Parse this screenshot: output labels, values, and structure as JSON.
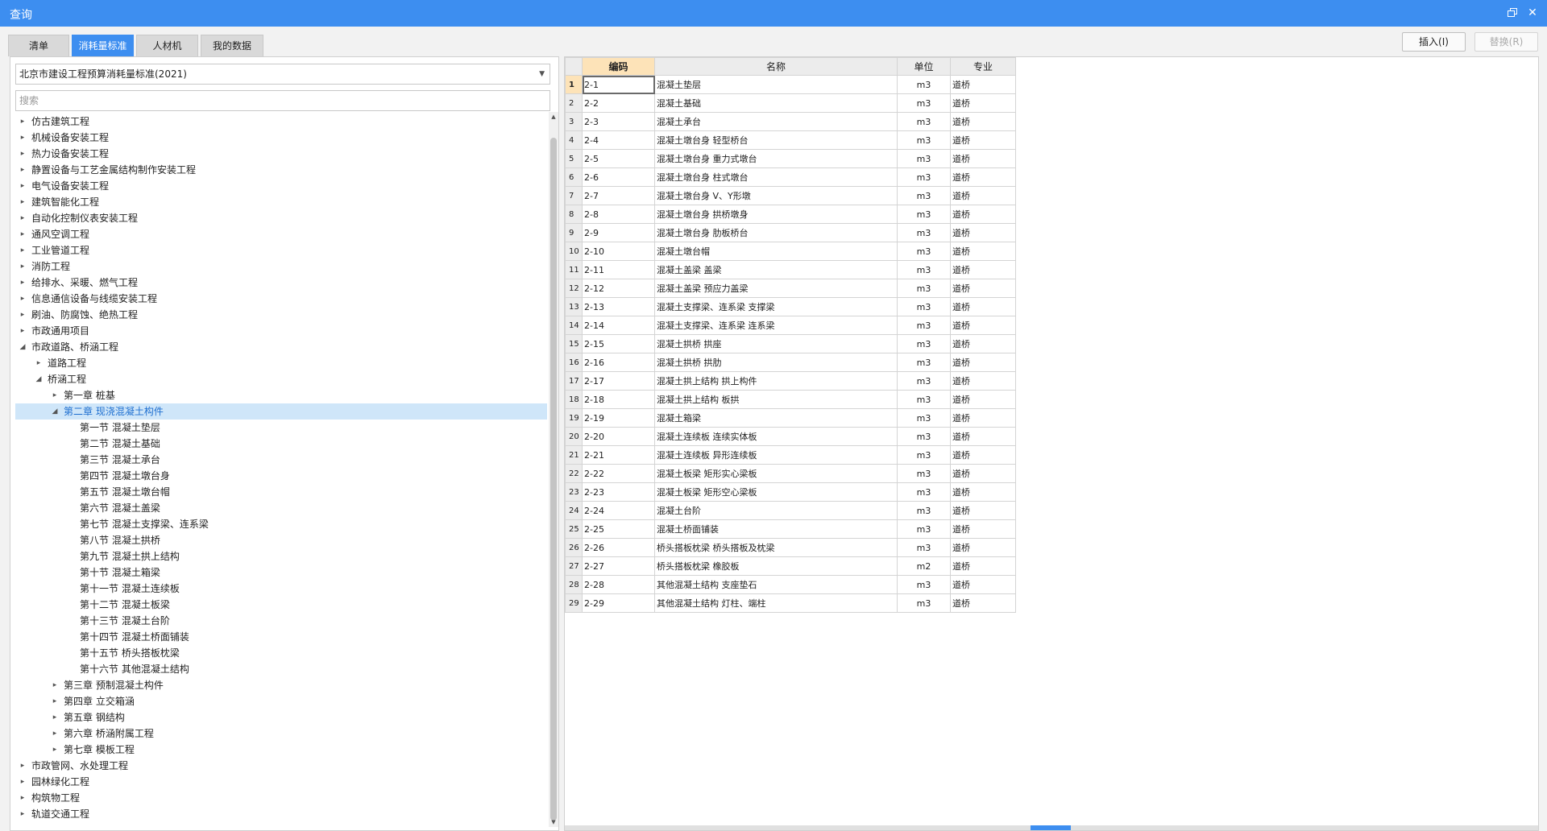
{
  "window": {
    "title": "查询",
    "restore_glyph": "restore-icon",
    "close_glyph": "✕"
  },
  "tabs": [
    {
      "label": "清单",
      "active": false
    },
    {
      "label": "消耗量标准",
      "active": true
    },
    {
      "label": "人材机",
      "active": false
    },
    {
      "label": "我的数据",
      "active": false
    }
  ],
  "buttons": {
    "insert": "插入(I)",
    "replace": "替换(R)"
  },
  "left": {
    "standard_select": "北京市建设工程预算消耗量标准(2021)",
    "search_placeholder": "搜索",
    "tree": [
      {
        "label": "仿古建筑工程",
        "level": 0,
        "state": "collapsed"
      },
      {
        "label": "机械设备安装工程",
        "level": 0,
        "state": "collapsed"
      },
      {
        "label": "热力设备安装工程",
        "level": 0,
        "state": "collapsed"
      },
      {
        "label": "静置设备与工艺金属结构制作安装工程",
        "level": 0,
        "state": "collapsed"
      },
      {
        "label": "电气设备安装工程",
        "level": 0,
        "state": "collapsed"
      },
      {
        "label": "建筑智能化工程",
        "level": 0,
        "state": "collapsed"
      },
      {
        "label": "自动化控制仪表安装工程",
        "level": 0,
        "state": "collapsed"
      },
      {
        "label": "通风空调工程",
        "level": 0,
        "state": "collapsed"
      },
      {
        "label": "工业管道工程",
        "level": 0,
        "state": "collapsed"
      },
      {
        "label": "消防工程",
        "level": 0,
        "state": "collapsed"
      },
      {
        "label": "给排水、采暖、燃气工程",
        "level": 0,
        "state": "collapsed"
      },
      {
        "label": "信息通信设备与线缆安装工程",
        "level": 0,
        "state": "collapsed"
      },
      {
        "label": "刷油、防腐蚀、绝热工程",
        "level": 0,
        "state": "collapsed"
      },
      {
        "label": "市政通用项目",
        "level": 0,
        "state": "collapsed"
      },
      {
        "label": "市政道路、桥涵工程",
        "level": 0,
        "state": "expanded"
      },
      {
        "label": "道路工程",
        "level": 1,
        "state": "collapsed"
      },
      {
        "label": "桥涵工程",
        "level": 1,
        "state": "expanded"
      },
      {
        "label": "第一章 桩基",
        "level": 2,
        "state": "collapsed"
      },
      {
        "label": "第二章 现浇混凝土构件",
        "level": 2,
        "state": "expanded",
        "selected": true
      },
      {
        "label": "第一节 混凝土垫层",
        "level": 3,
        "state": "leaf"
      },
      {
        "label": "第二节 混凝土基础",
        "level": 3,
        "state": "leaf"
      },
      {
        "label": "第三节 混凝土承台",
        "level": 3,
        "state": "leaf"
      },
      {
        "label": "第四节 混凝土墩台身",
        "level": 3,
        "state": "leaf"
      },
      {
        "label": "第五节 混凝土墩台帽",
        "level": 3,
        "state": "leaf"
      },
      {
        "label": "第六节 混凝土盖梁",
        "level": 3,
        "state": "leaf"
      },
      {
        "label": "第七节 混凝土支撑梁、连系梁",
        "level": 3,
        "state": "leaf"
      },
      {
        "label": "第八节 混凝土拱桥",
        "level": 3,
        "state": "leaf"
      },
      {
        "label": "第九节 混凝土拱上结构",
        "level": 3,
        "state": "leaf"
      },
      {
        "label": "第十节 混凝土箱梁",
        "level": 3,
        "state": "leaf"
      },
      {
        "label": "第十一节 混凝土连续板",
        "level": 3,
        "state": "leaf"
      },
      {
        "label": "第十二节 混凝土板梁",
        "level": 3,
        "state": "leaf"
      },
      {
        "label": "第十三节 混凝土台阶",
        "level": 3,
        "state": "leaf"
      },
      {
        "label": "第十四节 混凝土桥面铺装",
        "level": 3,
        "state": "leaf"
      },
      {
        "label": "第十五节 桥头搭板枕梁",
        "level": 3,
        "state": "leaf"
      },
      {
        "label": "第十六节 其他混凝土结构",
        "level": 3,
        "state": "leaf"
      },
      {
        "label": "第三章 预制混凝土构件",
        "level": 2,
        "state": "collapsed"
      },
      {
        "label": "第四章 立交箱涵",
        "level": 2,
        "state": "collapsed"
      },
      {
        "label": "第五章 钢结构",
        "level": 2,
        "state": "collapsed"
      },
      {
        "label": "第六章 桥涵附属工程",
        "level": 2,
        "state": "collapsed"
      },
      {
        "label": "第七章 模板工程",
        "level": 2,
        "state": "collapsed"
      },
      {
        "label": "市政管网、水处理工程",
        "level": 0,
        "state": "collapsed"
      },
      {
        "label": "园林绿化工程",
        "level": 0,
        "state": "collapsed"
      },
      {
        "label": "构筑物工程",
        "level": 0,
        "state": "collapsed"
      },
      {
        "label": "轨道交通工程",
        "level": 0,
        "state": "collapsed"
      }
    ]
  },
  "grid": {
    "columns": [
      "编码",
      "名称",
      "单位",
      "专业"
    ],
    "rows": [
      [
        "1",
        "2-1",
        "混凝土垫层",
        "m3",
        "道桥"
      ],
      [
        "2",
        "2-2",
        "混凝土基础",
        "m3",
        "道桥"
      ],
      [
        "3",
        "2-3",
        "混凝土承台",
        "m3",
        "道桥"
      ],
      [
        "4",
        "2-4",
        "混凝土墩台身 轻型桥台",
        "m3",
        "道桥"
      ],
      [
        "5",
        "2-5",
        "混凝土墩台身 重力式墩台",
        "m3",
        "道桥"
      ],
      [
        "6",
        "2-6",
        "混凝土墩台身 柱式墩台",
        "m3",
        "道桥"
      ],
      [
        "7",
        "2-7",
        "混凝土墩台身 V、Y形墩",
        "m3",
        "道桥"
      ],
      [
        "8",
        "2-8",
        "混凝土墩台身 拱桥墩身",
        "m3",
        "道桥"
      ],
      [
        "9",
        "2-9",
        "混凝土墩台身 肋板桥台",
        "m3",
        "道桥"
      ],
      [
        "10",
        "2-10",
        "混凝土墩台帽",
        "m3",
        "道桥"
      ],
      [
        "11",
        "2-11",
        "混凝土盖梁 盖梁",
        "m3",
        "道桥"
      ],
      [
        "12",
        "2-12",
        "混凝土盖梁 预应力盖梁",
        "m3",
        "道桥"
      ],
      [
        "13",
        "2-13",
        "混凝土支撑梁、连系梁 支撑梁",
        "m3",
        "道桥"
      ],
      [
        "14",
        "2-14",
        "混凝土支撑梁、连系梁 连系梁",
        "m3",
        "道桥"
      ],
      [
        "15",
        "2-15",
        "混凝土拱桥 拱座",
        "m3",
        "道桥"
      ],
      [
        "16",
        "2-16",
        "混凝土拱桥 拱肋",
        "m3",
        "道桥"
      ],
      [
        "17",
        "2-17",
        "混凝土拱上结构 拱上构件",
        "m3",
        "道桥"
      ],
      [
        "18",
        "2-18",
        "混凝土拱上结构 板拱",
        "m3",
        "道桥"
      ],
      [
        "19",
        "2-19",
        "混凝土箱梁",
        "m3",
        "道桥"
      ],
      [
        "20",
        "2-20",
        "混凝土连续板 连续实体板",
        "m3",
        "道桥"
      ],
      [
        "21",
        "2-21",
        "混凝土连续板 异形连续板",
        "m3",
        "道桥"
      ],
      [
        "22",
        "2-22",
        "混凝土板梁 矩形实心梁板",
        "m3",
        "道桥"
      ],
      [
        "23",
        "2-23",
        "混凝土板梁 矩形空心梁板",
        "m3",
        "道桥"
      ],
      [
        "24",
        "2-24",
        "混凝土台阶",
        "m3",
        "道桥"
      ],
      [
        "25",
        "2-25",
        "混凝土桥面铺装",
        "m3",
        "道桥"
      ],
      [
        "26",
        "2-26",
        "桥头搭板枕梁 桥头搭板及枕梁",
        "m3",
        "道桥"
      ],
      [
        "27",
        "2-27",
        "桥头搭板枕梁 橡胶板",
        "m2",
        "道桥"
      ],
      [
        "28",
        "2-28",
        "其他混凝土结构 支座垫石",
        "m3",
        "道桥"
      ],
      [
        "29",
        "2-29",
        "其他混凝土结构 灯柱、端柱",
        "m3",
        "道桥"
      ]
    ]
  }
}
